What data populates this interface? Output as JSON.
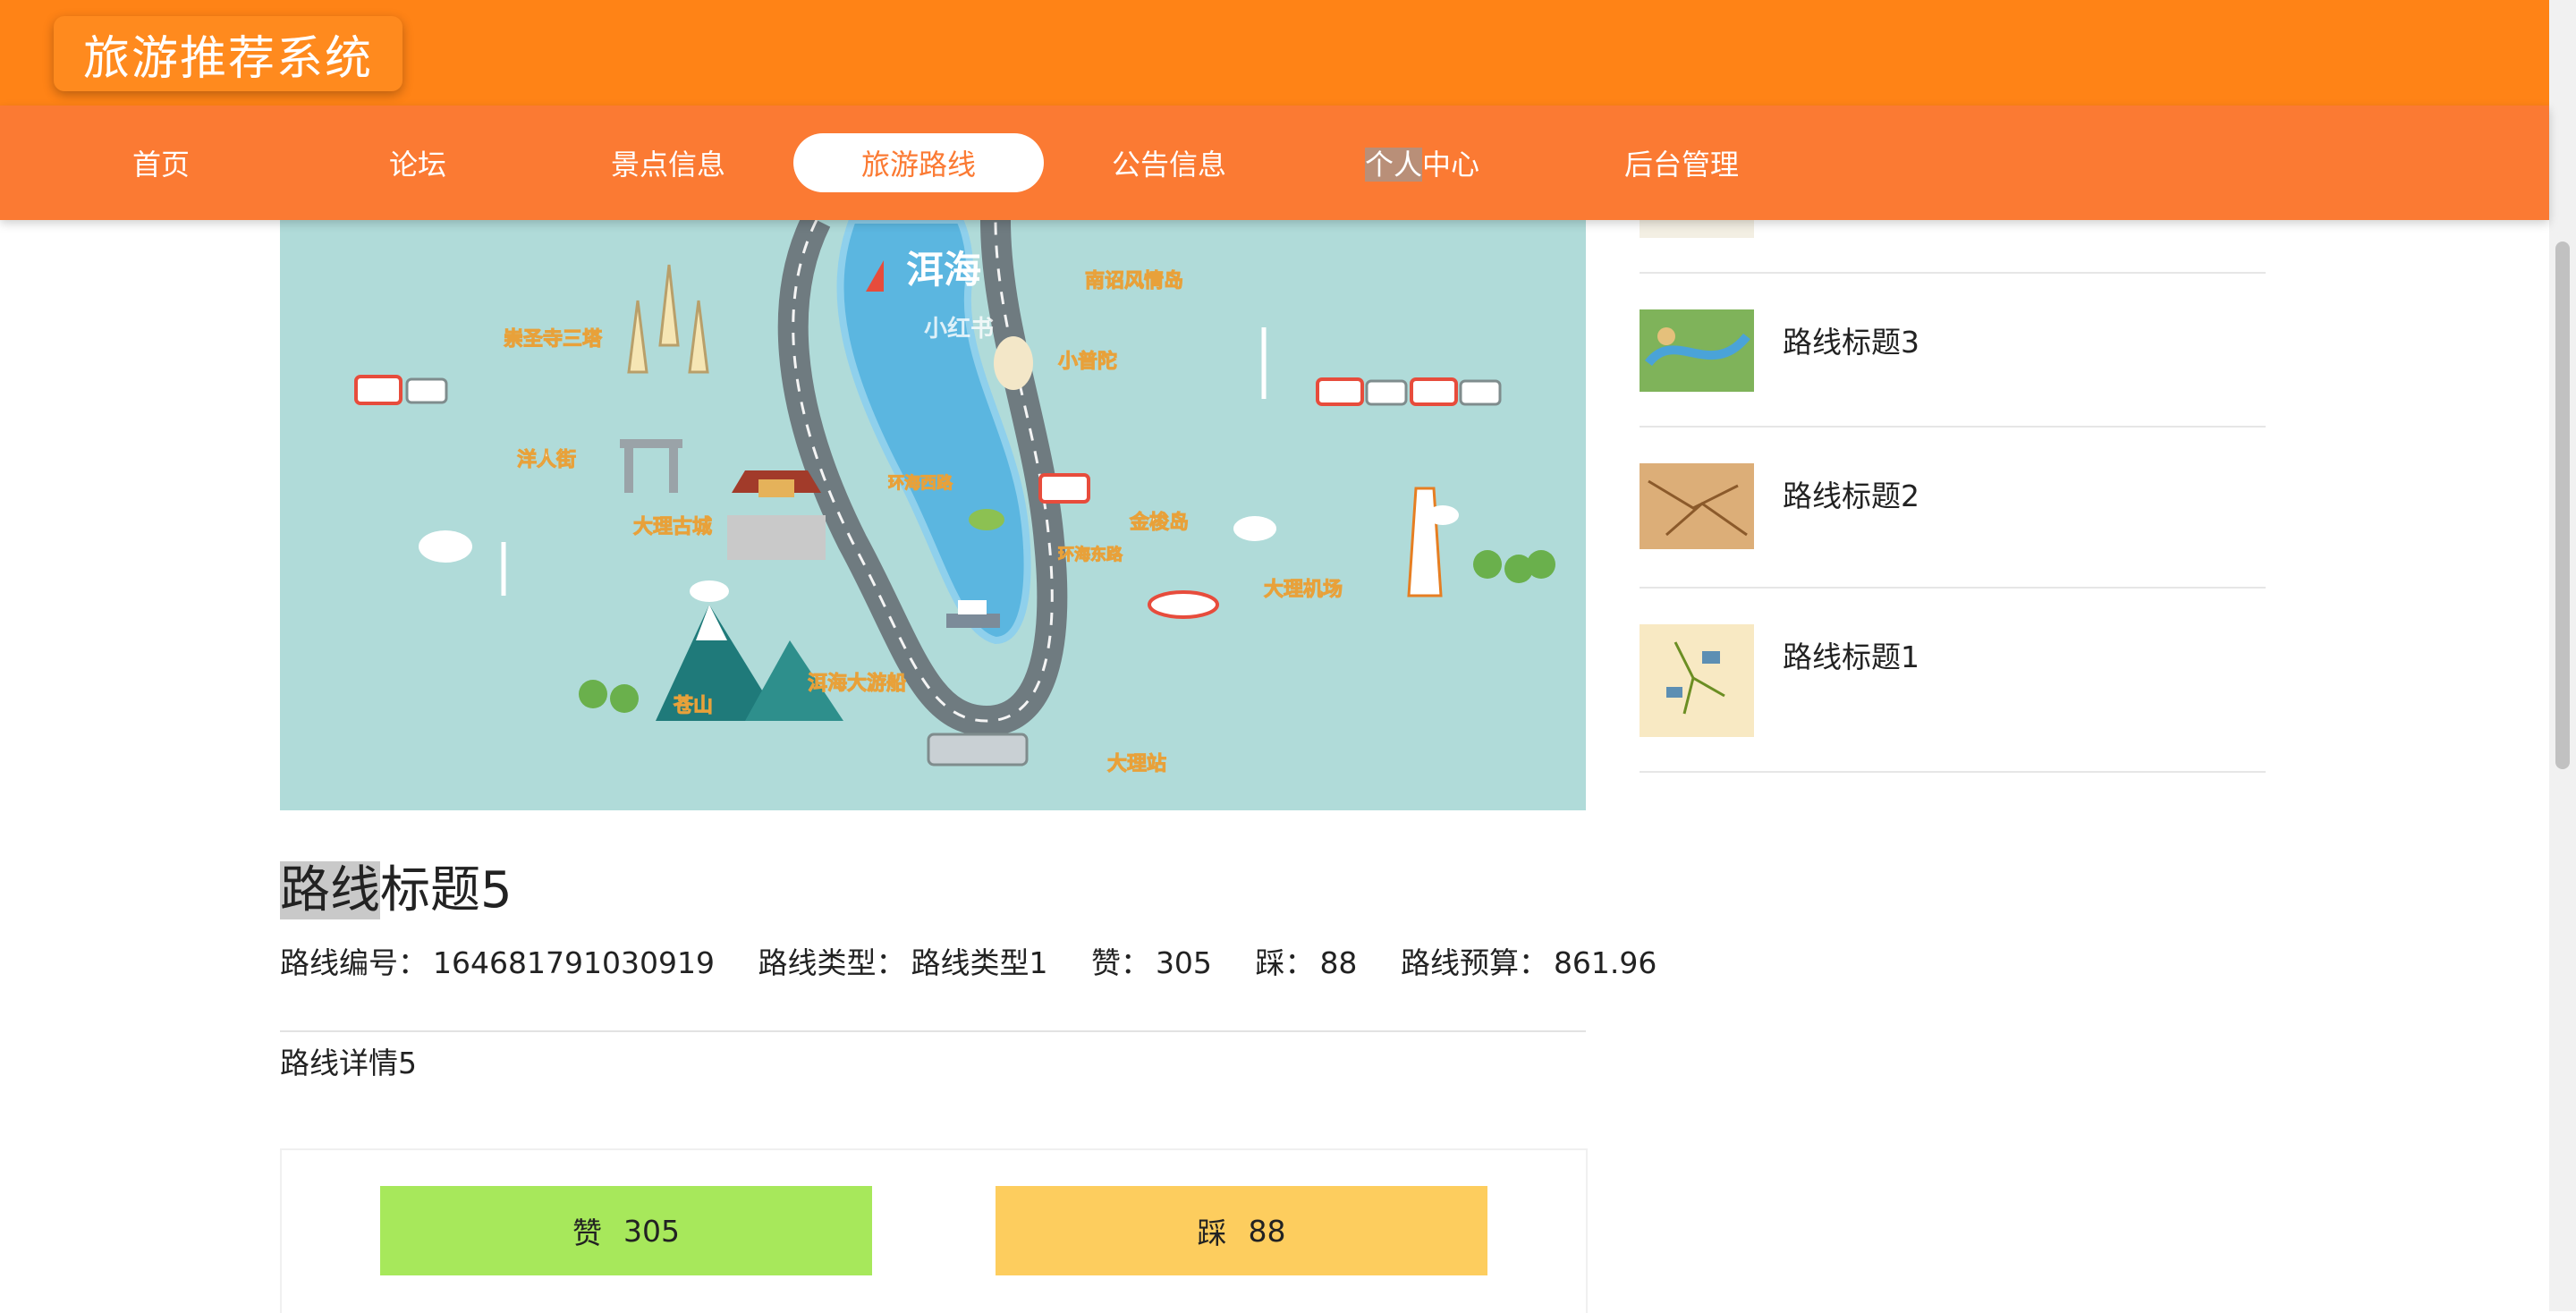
{
  "app": {
    "title": "旅游推荐系统"
  },
  "nav": {
    "items": [
      {
        "label": "首页"
      },
      {
        "label": "论坛"
      },
      {
        "label": "景点信息"
      },
      {
        "label": "旅游路线",
        "active": true
      },
      {
        "label": "公告信息"
      },
      {
        "label": "个人中心"
      },
      {
        "label": "后台管理"
      }
    ]
  },
  "map_labels": {
    "lake": "洱海",
    "watermark": "小红书",
    "places": [
      "南诏风情岛",
      "崇圣寺三塔",
      "小普陀",
      "洋人街",
      "大理古城",
      "环海西路",
      "环海东路",
      "金梭岛",
      "大理机场",
      "苍山",
      "洱海大游船",
      "大理站"
    ]
  },
  "route": {
    "title": "路线标题5",
    "number_label": "路线编号：",
    "number": "164681791030919",
    "type_label": "路线类型：",
    "type": "路线类型1",
    "like_label": "赞：",
    "likes": "305",
    "dislike_label": "踩：",
    "dislikes": "88",
    "budget_label": "路线预算：",
    "budget": "861.96",
    "detail": "路线详情5"
  },
  "buttons": {
    "like": "赞",
    "like_count": "305",
    "dislike": "踩",
    "dislike_count": "88"
  },
  "sidebar": {
    "items": [
      {
        "label": "路线标题3"
      },
      {
        "label": "路线标题2"
      },
      {
        "label": "路线标题1"
      }
    ]
  },
  "colors": {
    "header": "#ff8316",
    "nav": "#fb7a33",
    "like_button": "#a7e85b",
    "dislike_button": "#fdcd5e",
    "map_water": "#5bb6e0",
    "map_land": "#b0dbd9"
  }
}
